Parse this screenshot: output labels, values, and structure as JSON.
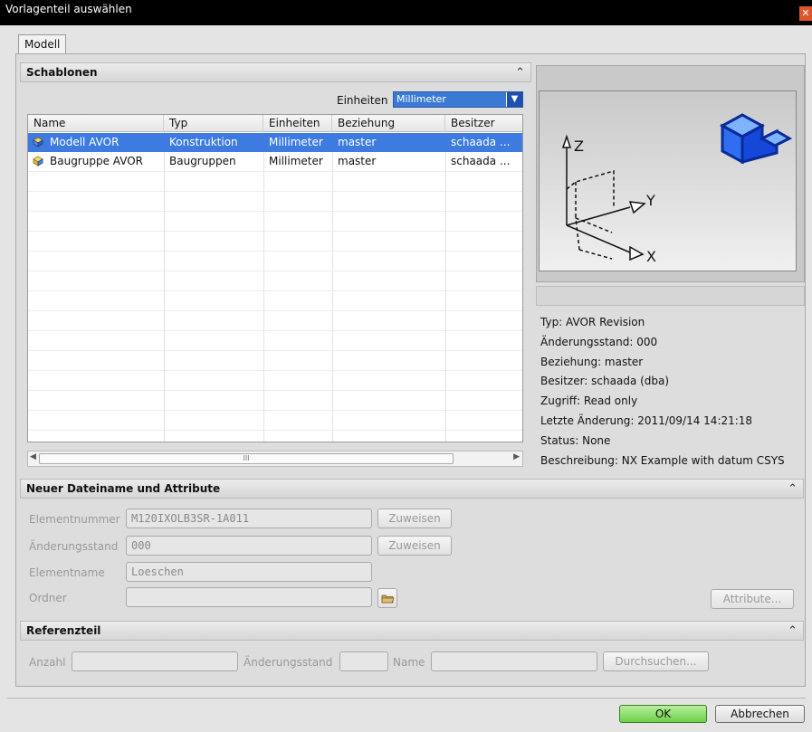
{
  "window": {
    "title": "Vorlagenteil auswählen",
    "close_glyph": "✕"
  },
  "tabs": [
    {
      "label": "Modell"
    }
  ],
  "templates": {
    "title": "Schablonen",
    "units_label": "Einheiten",
    "units_value": "Millimeter",
    "columns": [
      "Name",
      "Typ",
      "Einheiten",
      "Beziehung",
      "Besitzer"
    ],
    "rows": [
      {
        "name": "Modell AVOR",
        "type": "Konstruktion",
        "units": "Millimeter",
        "relation": "master",
        "owner": "schaada ...",
        "icon": "part-icon",
        "selected": true
      },
      {
        "name": "Baugruppe AVOR",
        "type": "Baugruppen",
        "units": "Millimeter",
        "relation": "master",
        "owner": "schaada ...",
        "icon": "assembly-icon",
        "selected": false
      }
    ],
    "scroll_grip": "III"
  },
  "preview": {
    "axis_x": "X",
    "axis_y": "Y",
    "axis_z": "Z",
    "info": [
      "Typ: AVOR Revision",
      "Änderungsstand: 000",
      "Beziehung: master",
      "Besitzer: schaada (dba)",
      "Zugriff: Read only",
      "Letzte Änderung: 2011/09/14 14:21:18",
      "Status: None",
      "Beschreibung: NX Example with datum CSYS"
    ]
  },
  "new_file": {
    "title": "Neuer Dateiname und Attribute",
    "element_number_label": "Elementnummer",
    "element_number_value": "M120IXOLB3SR-1A011",
    "revision_label": "Änderungsstand",
    "revision_value": "000",
    "element_name_label": "Elementname",
    "element_name_value": "Loeschen",
    "folder_label": "Ordner",
    "folder_value": "",
    "assign_label": "Zuweisen",
    "attributes_label": "Attribute..."
  },
  "reference": {
    "title": "Referenzteil",
    "count_label": "Anzahl",
    "revision_label": "Änderungsstand",
    "name_label": "Name",
    "browse_label": "Durchsuchen..."
  },
  "footer": {
    "ok_label": "OK",
    "cancel_label": "Abbrechen"
  },
  "colors": {
    "selection": "#3d7be0",
    "ok_green": "#6dd04a",
    "title_bar": "#000000",
    "close_red": "#e0552a"
  }
}
